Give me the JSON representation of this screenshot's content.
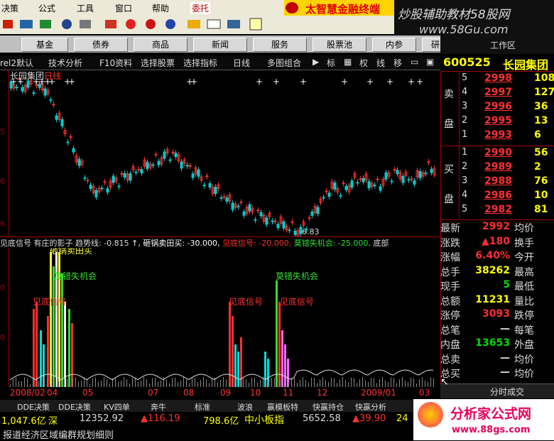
{
  "menu": {
    "items": [
      "决策",
      "公式",
      "工具",
      "窗口",
      "帮助"
    ],
    "active": "委托",
    "brand_text": "太智慧金融终端"
  },
  "watermarks": {
    "top": "炒股辅助教材58股网",
    "url": "www.58Gu.com",
    "bottom_brand": "分析家公式网",
    "bottom_url": "www.88gs.com"
  },
  "nav": {
    "buttons": [
      "基金",
      "债券",
      "商品",
      "新闻",
      "服务",
      "股票池",
      "内参",
      "研究室"
    ],
    "workspace": "工作区"
  },
  "analysis_toolbar": {
    "items": [
      "技术分析",
      "F10资料",
      "选择股票",
      "选择指标",
      "日线",
      "多图组合",
      "标",
      "权",
      "线",
      "移"
    ],
    "left_fragment": "rel2默认"
  },
  "main_chart": {
    "title": "长园集团",
    "period": "日线",
    "low_label": "6.83",
    "marker_glyph": "+",
    "axis_ticks": [
      "5",
      "6",
      "6"
    ]
  },
  "indicator": {
    "header_items": [
      {
        "text": "见底信号",
        "color": "#dddddd"
      },
      {
        "text": "有庄的影子",
        "color": "#dddddd"
      },
      {
        "text": "趋势线: -0.815",
        "color": "#dddddd"
      },
      {
        "text": "↑, 砸锅卖田买: -30.000,",
        "color": "#ffffff"
      },
      {
        "text": "见底信号: -20.000,",
        "color": "#ff3030"
      },
      {
        "text": "莫错失机会: -25.000,",
        "color": "#33dd33"
      },
      {
        "text": "底部",
        "color": "#dddddd"
      }
    ],
    "annotations": [
      {
        "text": "砸锅卖田买",
        "color": "#ffff33"
      },
      {
        "text": "莫错失机会",
        "color": "#33dd33"
      },
      {
        "text": "见底信号",
        "color": "#ff3030"
      },
      {
        "text": "见底信号",
        "color": "#ff3030"
      },
      {
        "text": "见底信号",
        "color": "#ff3030"
      },
      {
        "text": "莫错失机会",
        "color": "#33dd33"
      }
    ],
    "axis_ticks": [
      "0",
      "0"
    ]
  },
  "date_axis": [
    "2008/02",
    "04",
    "05",
    "07",
    "08",
    "09",
    "10",
    "11",
    "12",
    "2009/01",
    "03"
  ],
  "stock": {
    "code": "600525",
    "name": "长园集团",
    "sell_label": [
      "卖",
      "盘"
    ],
    "buy_label": [
      "买",
      "盘"
    ],
    "asks": [
      {
        "n": "5",
        "price": "2998",
        "vol": "108"
      },
      {
        "n": "4",
        "price": "2997",
        "vol": "127"
      },
      {
        "n": "3",
        "price": "2996",
        "vol": "36"
      },
      {
        "n": "2",
        "price": "2995",
        "vol": "13"
      },
      {
        "n": "1",
        "price": "2993",
        "vol": "6"
      }
    ],
    "bids": [
      {
        "n": "1",
        "price": "2990",
        "vol": "56"
      },
      {
        "n": "2",
        "price": "2989",
        "vol": "2"
      },
      {
        "n": "3",
        "price": "2988",
        "vol": "76"
      },
      {
        "n": "4",
        "price": "2986",
        "vol": "10"
      },
      {
        "n": "5",
        "price": "2982",
        "vol": "81"
      }
    ],
    "quote_rows": [
      {
        "l1": "最新",
        "v1": "2992",
        "c1": "red",
        "l2": "均价"
      },
      {
        "l1": "涨跌",
        "v1": "▲180",
        "c1": "red",
        "l2": "换手"
      },
      {
        "l1": "涨幅",
        "v1": "6.40%",
        "c1": "red",
        "l2": "今开"
      },
      {
        "l1": "总手",
        "v1": "38262",
        "c1": "yel",
        "l2": "最高"
      },
      {
        "l1": "现手",
        "v1": "5",
        "c1": "grn",
        "l2": "最低"
      },
      {
        "l1": "总额",
        "v1": "11231",
        "c1": "yel",
        "l2": "量比"
      },
      {
        "l1": "涨停",
        "v1": "3093",
        "c1": "red",
        "l2": "跌停"
      },
      {
        "l1": "总笔",
        "v1": "—",
        "c1": "lbl",
        "l2": "每笔"
      },
      {
        "l1": "内盘",
        "v1": "13653",
        "c1": "grn",
        "l2": "外盘"
      },
      {
        "l1": "总卖",
        "v1": "—",
        "c1": "lbl",
        "l2": "均价"
      },
      {
        "l1": "总买",
        "v1": "—",
        "c1": "lbl",
        "l2": "均价"
      }
    ],
    "tick_button": "分时成交"
  },
  "bottom_tabs": [
    "DDE决策",
    "DDE决策",
    "KV四单",
    "奔牛",
    "标准",
    "波浪",
    "赢模板特",
    "快赢持仓",
    "快赢分析"
  ],
  "status": {
    "sh_value": "1,047.6亿",
    "sz_label": "深",
    "sz_index": "12352.92",
    "sz_change": "▲116.19",
    "sz_amount": "798.6亿",
    "sme_label": "中小板指",
    "sme_index": "5652.58",
    "sme_change": "▲39.90",
    "extra": "24"
  },
  "news_ticker": "报道经济区域编群规划细则"
}
